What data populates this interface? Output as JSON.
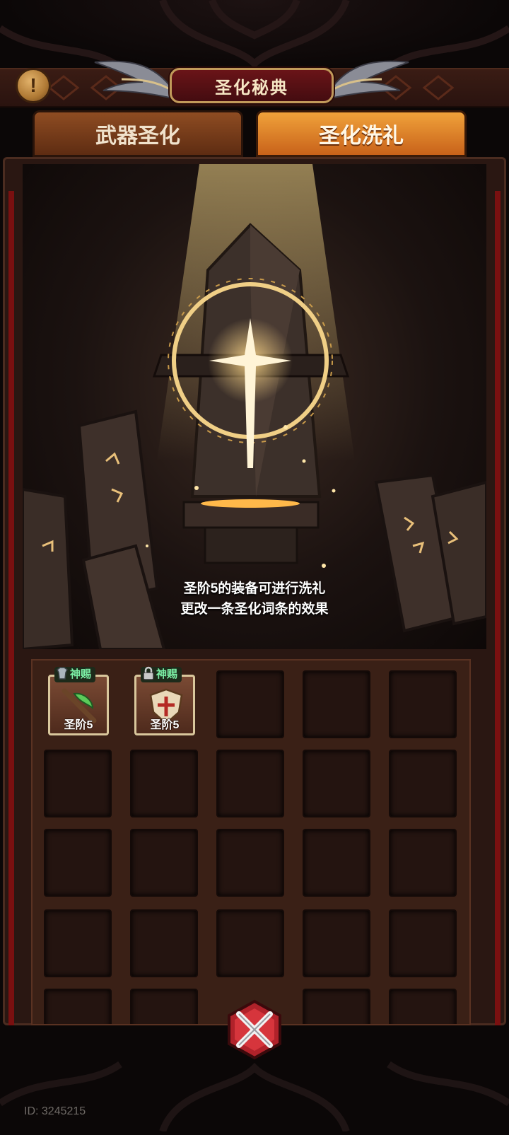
{
  "header": {
    "title": "圣化秘典",
    "info_icon": "exclamation-icon"
  },
  "tabs": [
    {
      "label": "武器圣化",
      "active": false
    },
    {
      "label": "圣化洗礼",
      "active": true
    }
  ],
  "scene": {
    "caption_line1": "圣阶5的装备可进行洗礼",
    "caption_line2": "更改一条圣化词条的效果"
  },
  "inventory": {
    "items": [
      {
        "badge": "神赐",
        "badge_icon": "armor-icon",
        "level_label": "圣阶5",
        "art_icon": "green-staff-icon"
      },
      {
        "badge": "神赐",
        "badge_icon": "lock-icon",
        "level_label": "圣阶5",
        "art_icon": "shield-icon"
      }
    ]
  },
  "footer": {
    "close_icon": "crossed-swords-close-icon",
    "user_id": "ID: 3245215"
  },
  "colors": {
    "active_tab": "#e48a2a",
    "title_plate": "#5a1014",
    "badge_text": "#7cf0a6"
  }
}
